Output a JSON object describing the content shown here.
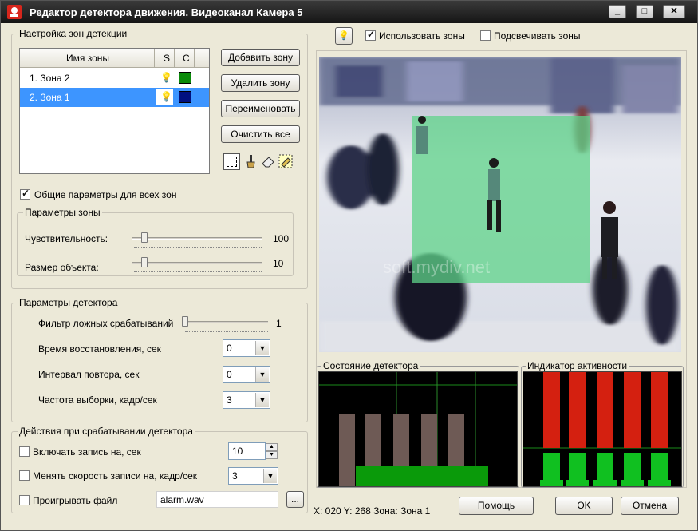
{
  "window": {
    "title": "Редактор детектора движения. Видеоканал Камера 5",
    "min": "_",
    "max": "□",
    "close": "✕"
  },
  "zones": {
    "group_label": "Настройка зон детекции",
    "headers": [
      "Имя зоны",
      "S",
      "C"
    ],
    "rows": [
      {
        "name": "1. Зона 2",
        "color": "#0a8a0a"
      },
      {
        "name": "2. Зона 1",
        "color": "#001080"
      }
    ],
    "buttons": {
      "add": "Добавить зону",
      "delete": "Удалить зону",
      "rename": "Переименовать",
      "clear": "Очистить все"
    },
    "tools": [
      "select-rect-icon",
      "brush-icon",
      "eraser-icon",
      "fill-icon"
    ]
  },
  "common_params": {
    "label": "Общие параметры для всех зон",
    "checked": true
  },
  "zone_params": {
    "label": "Параметры зоны",
    "sensitivity": {
      "label": "Чувствительность:",
      "value": "100",
      "pos": 0.1
    },
    "object_size": {
      "label": "Размер объекта:",
      "value": "10",
      "pos": 0.1
    }
  },
  "detector_params": {
    "label": "Параметры детектора",
    "false_filter": {
      "label": "Фильтр ложных срабатываний",
      "value": "1",
      "pos": 0.0
    },
    "recovery": {
      "label": "Время восстановления, сек",
      "value": "0"
    },
    "repeat": {
      "label": "Интервал повтора, сек",
      "value": "0"
    },
    "sample_rate": {
      "label": "Частота выборки, кадр/сек",
      "value": "3"
    }
  },
  "actions": {
    "label": "Действия при срабатывании детектора",
    "record": {
      "label": "Включать запись на, сек",
      "value": "10"
    },
    "speed": {
      "label": "Менять скорость записи на, кадр/сек",
      "value": "3"
    },
    "play": {
      "label": "Проигрывать файл",
      "value": "alarm.wav",
      "browse": "..."
    }
  },
  "top": {
    "use_zones": "Использовать зоны",
    "highlight_zones": "Подсвечивать зоны"
  },
  "preview": {
    "watermark": "soft.mydiv.net"
  },
  "detector_state": {
    "label": "Состояние детектора"
  },
  "activity": {
    "label": "Индикатор активности"
  },
  "status": {
    "text": "X: 020  Y: 268 Зона: Зона 1"
  },
  "footer": {
    "help": "Помощь",
    "ok": "OK",
    "cancel": "Отмена"
  },
  "chart_data": [
    {
      "type": "bar",
      "title": "Состояние детектора",
      "series": [
        {
          "values": [
            1,
            1,
            1,
            1,
            1
          ],
          "color": "#6e5a55"
        },
        {
          "values": [
            0.2,
            0.2,
            0.2,
            0.2,
            0.2,
            0.2
          ],
          "color": "#0a9a0a"
        }
      ]
    },
    {
      "type": "bar",
      "title": "Индикатор активности",
      "series": [
        {
          "values": [
            1,
            1,
            1,
            1,
            1
          ],
          "color": "#d42010"
        },
        {
          "values": [
            0.42,
            0.42,
            0.42,
            0.42,
            0.42
          ],
          "color": "#10c020"
        }
      ]
    }
  ]
}
